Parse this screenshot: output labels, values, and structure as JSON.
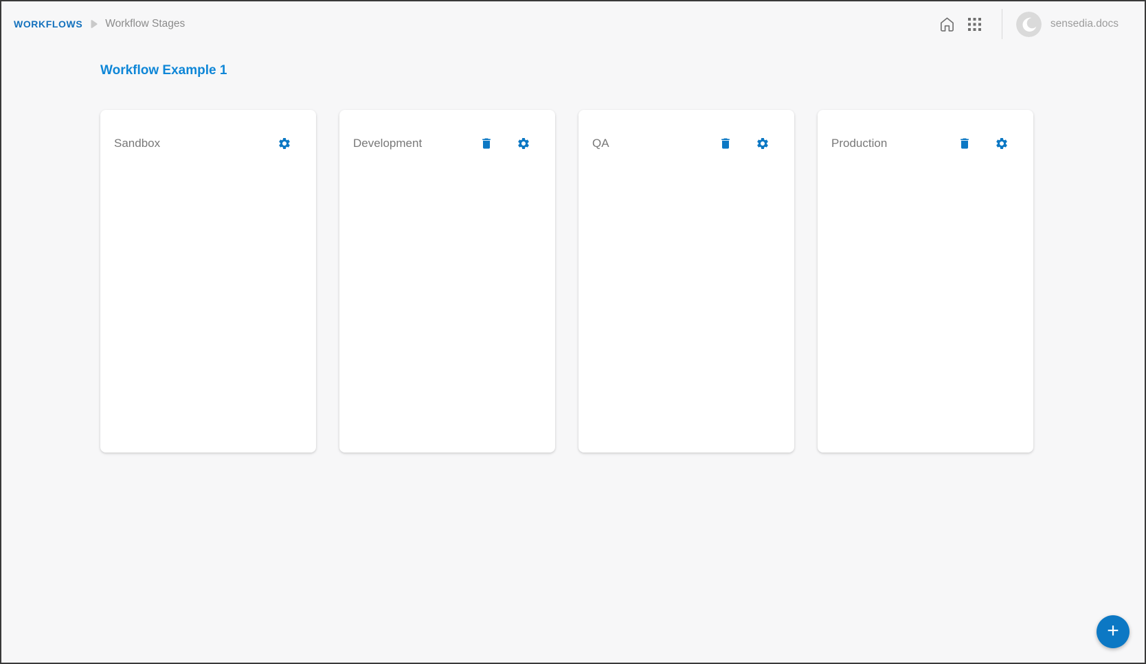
{
  "header": {
    "breadcrumb": {
      "root": "WORKFLOWS",
      "separator_icon": "triangle-right-icon",
      "current": "Workflow Stages"
    },
    "actions": {
      "home_icon": "home-icon",
      "apps_icon": "apps-grid-icon"
    },
    "account": {
      "logo_icon": "sensedia-logo-icon",
      "name": "sensedia.docs"
    }
  },
  "page": {
    "title": "Workflow Example 1"
  },
  "stages": [
    {
      "name": "Sandbox",
      "actions": [
        "settings"
      ]
    },
    {
      "name": "Development",
      "actions": [
        "delete",
        "settings"
      ]
    },
    {
      "name": "QA",
      "actions": [
        "delete",
        "settings"
      ]
    },
    {
      "name": "Production",
      "actions": [
        "delete",
        "settings"
      ]
    }
  ],
  "fab": {
    "label": "+"
  },
  "colors": {
    "accent_blue": "#0c78c4",
    "title_blue": "#0e86d7",
    "breadcrumb_blue": "#1371bd",
    "page_background": "#f7f7f8"
  }
}
